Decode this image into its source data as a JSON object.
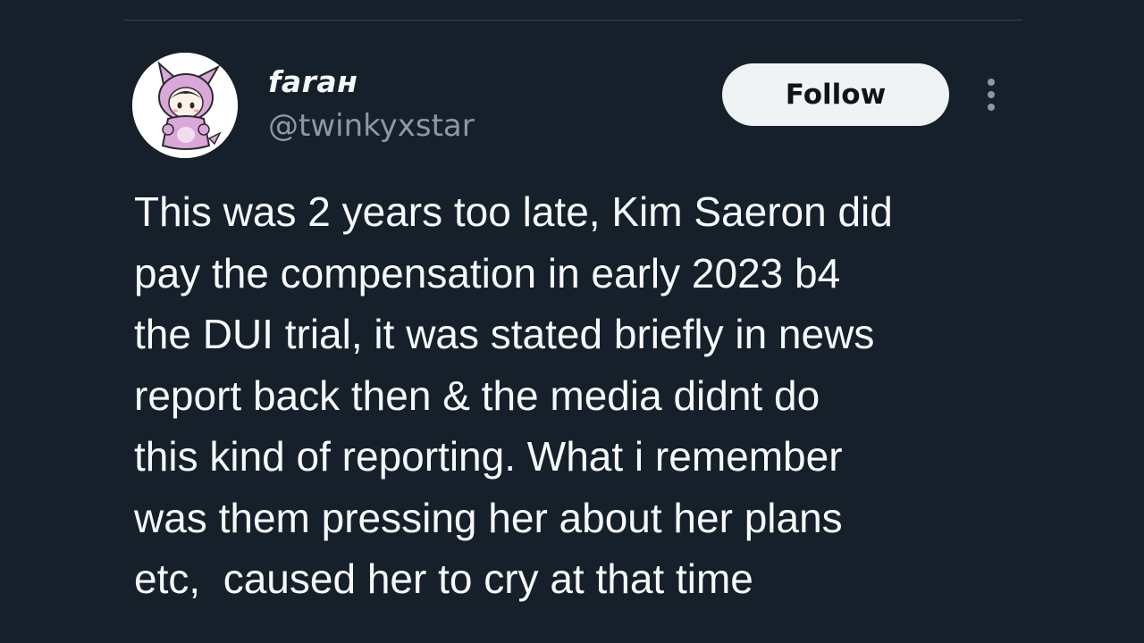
{
  "tweet": {
    "author": {
      "display_name": "faraн",
      "handle": "@twinkyxstar",
      "avatar_icon": "avatar-pink-bunny-costume-icon"
    },
    "follow_label": "Follow",
    "more_icon": "more-vertical-icon",
    "text_lines": [
      "This was 2 years too late, Kim Saeron did",
      "pay the compensation in early 2023 b4",
      "the DUI trial, it was stated briefly in news",
      "report back then & the media didnt do",
      "this kind of reporting. What i remember",
      "was them pressing her about her plans",
      "etc,  caused her to cry at that time"
    ]
  },
  "colors": {
    "background": "#15202b",
    "text": "#f7f9f9",
    "secondary_text": "#8b98a5",
    "button_bg": "#eff3f4",
    "button_text": "#0f1419"
  }
}
